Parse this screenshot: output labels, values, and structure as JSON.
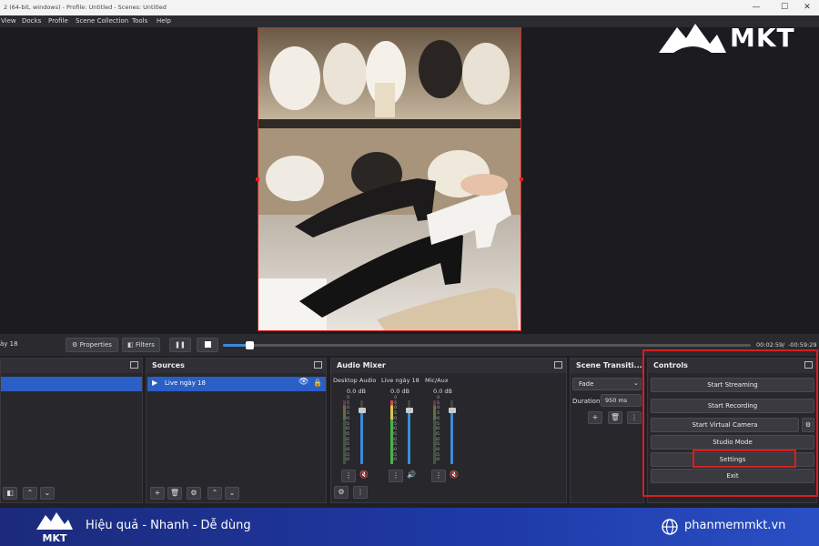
{
  "window": {
    "title": "2 (64-bit, windows) - Profile: Untitled - Scenes: Untitled",
    "minimize": "—",
    "maximize": "☐",
    "close": "✕"
  },
  "menu": {
    "items": [
      "View",
      "Docks",
      "Profile",
      "Scene Collection",
      "Tools",
      "Help"
    ]
  },
  "logo_top": {
    "text": "MKT"
  },
  "transport": {
    "source_name": "ày 18",
    "properties_label": "Properties",
    "filters_label": "Filters",
    "time_current": "00:02:59",
    "time_sep": "/",
    "time_remaining": "-00:59:29",
    "progress": 0.05
  },
  "scenes_dock": {
    "title": ""
  },
  "sources_dock": {
    "title": "Sources",
    "items": [
      {
        "name": "Live ngày 18"
      }
    ]
  },
  "audio_mixer": {
    "title": "Audio Mixer",
    "channels": [
      {
        "name": "Desktop Audio",
        "db": "0.0 dB",
        "level": 0.85
      },
      {
        "name": "Live ngày 18",
        "db": "0.0 dB",
        "level": 0.85
      },
      {
        "name": "Mic/Aux",
        "db": "0.0 dB",
        "level": 0.85
      }
    ],
    "scale": [
      "0",
      "-5",
      "-10",
      "-15",
      "-20",
      "-25",
      "-30",
      "-35",
      "-40",
      "-45",
      "-50",
      "-55",
      "-60"
    ]
  },
  "scene_transitions": {
    "title": "Scene Transiti...",
    "transition": "Fade",
    "duration_label": "Duration",
    "duration_value": "950 ms"
  },
  "controls": {
    "title": "Controls",
    "start_streaming": "Start Streaming",
    "start_recording": "Start Recording",
    "start_virtual_camera": "Start Virtual Camera",
    "studio_mode": "Studio Mode",
    "settings": "Settings",
    "exit": "Exit"
  },
  "banner": {
    "logo_text": "MKT",
    "slogan": "Hiệu quả - Nhanh - Dễ dùng",
    "website": "phanmemmkt.vn"
  },
  "colors": {
    "accent": "#3b8bd8",
    "highlight_red": "#d42020",
    "selected_row": "#2a5fc6",
    "banner_blue": "#1f3aa8"
  }
}
